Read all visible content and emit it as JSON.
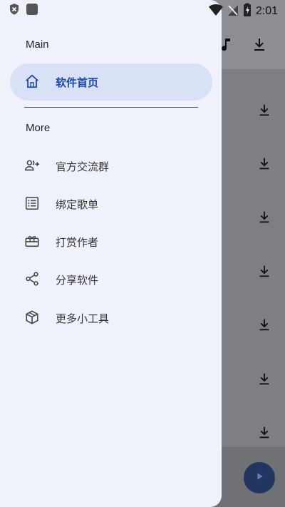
{
  "status": {
    "time": "2:01",
    "icons": [
      "close-badge-icon",
      "square-app-icon",
      "wifi-icon",
      "no-signal-icon",
      "battery-charging-icon"
    ]
  },
  "drawer": {
    "sections": [
      {
        "title": "Main",
        "items": [
          {
            "label": "软件首页",
            "icon": "home-icon",
            "active": true
          }
        ]
      },
      {
        "title": "More",
        "items": [
          {
            "label": "官方交流群",
            "icon": "group-add-icon"
          },
          {
            "label": "绑定歌单",
            "icon": "list-icon"
          },
          {
            "label": "打赏作者",
            "icon": "gift-icon"
          },
          {
            "label": "分享软件",
            "icon": "share-icon"
          },
          {
            "label": "更多小工具",
            "icon": "box-icon"
          }
        ]
      }
    ]
  },
  "background": {
    "toolbar_icons": [
      "music-note-icon",
      "download-icon"
    ],
    "download_buttons": 7,
    "fab_icon": "play-icon"
  },
  "colors": {
    "drawer_bg": "#f0f2fb",
    "active_item_bg": "#d9e1f7",
    "active_accent": "#1f4aa8",
    "fab": "#21365f"
  }
}
